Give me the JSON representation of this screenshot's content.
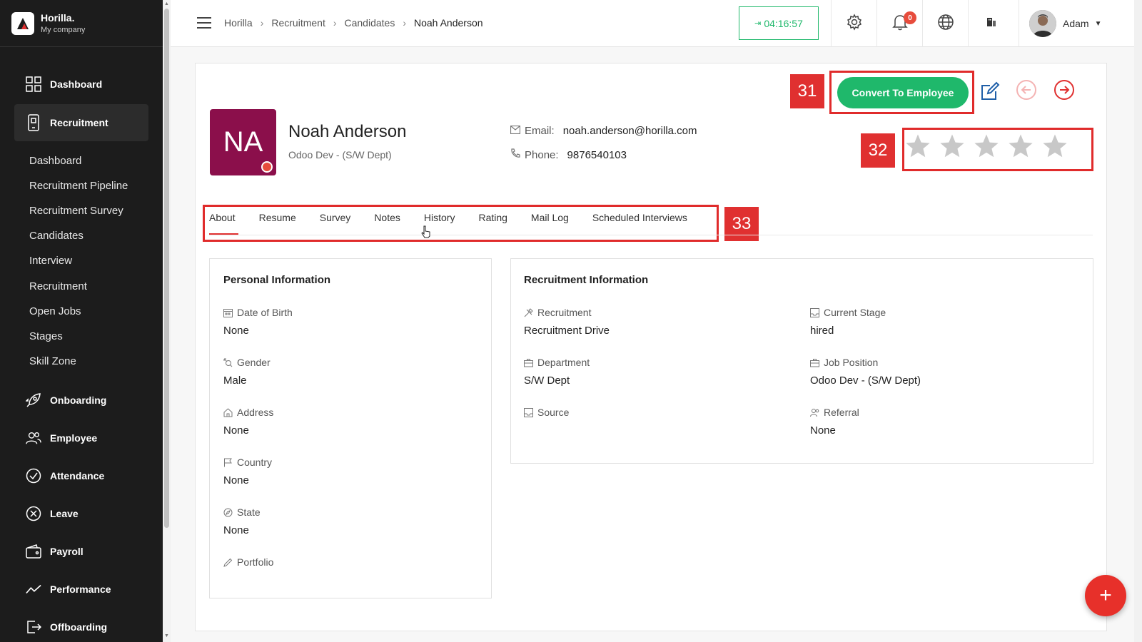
{
  "brand": {
    "name": "Horilla.",
    "company": "My company"
  },
  "sidebar": {
    "main_top": [
      {
        "label": "Dashboard",
        "icon": "grid-icon"
      },
      {
        "label": "Recruitment",
        "icon": "phone-icon"
      }
    ],
    "sub_items": [
      "Dashboard",
      "Recruitment Pipeline",
      "Recruitment Survey",
      "Candidates",
      "Interview",
      "Recruitment",
      "Open Jobs",
      "Stages",
      "Skill Zone"
    ],
    "main_bottom": [
      {
        "label": "Onboarding",
        "icon": "rocket-icon"
      },
      {
        "label": "Employee",
        "icon": "users-icon"
      },
      {
        "label": "Attendance",
        "icon": "check-circle-icon"
      },
      {
        "label": "Leave",
        "icon": "x-circle-icon"
      },
      {
        "label": "Payroll",
        "icon": "wallet-icon"
      },
      {
        "label": "Performance",
        "icon": "trend-icon"
      },
      {
        "label": "Offboarding",
        "icon": "exit-icon"
      }
    ]
  },
  "topbar": {
    "breadcrumb": [
      "Horilla",
      "Recruitment",
      "Candidates",
      "Noah Anderson"
    ],
    "timer": "04:16:57",
    "notification_count": "0",
    "user_name": "Adam"
  },
  "candidate": {
    "initials": "NA",
    "name": "Noah Anderson",
    "job": "Odoo Dev - (S/W Dept)",
    "email_label": "Email:",
    "email": "noah.anderson@horilla.com",
    "phone_label": "Phone:",
    "phone": "9876540103",
    "rating": 0
  },
  "actions": {
    "convert_label": "Convert To Employee"
  },
  "markers": {
    "m31": "31",
    "m32": "32",
    "m33": "33"
  },
  "tabs": [
    "About",
    "Resume",
    "Survey",
    "Notes",
    "History",
    "Rating",
    "Mail Log",
    "Scheduled Interviews"
  ],
  "personal": {
    "title": "Personal Information",
    "fields": [
      {
        "label": "Date of Birth",
        "value": "None"
      },
      {
        "label": "Gender",
        "value": "Male"
      },
      {
        "label": "Address",
        "value": "None"
      },
      {
        "label": "Country",
        "value": "None"
      },
      {
        "label": "State",
        "value": "None"
      },
      {
        "label": "Portfolio",
        "value": ""
      }
    ]
  },
  "recruitment_info": {
    "title": "Recruitment Information",
    "left": [
      {
        "label": "Recruitment",
        "value": "Recruitment Drive"
      },
      {
        "label": "Department",
        "value": "S/W Dept"
      },
      {
        "label": "Source",
        "value": ""
      }
    ],
    "right": [
      {
        "label": "Current Stage",
        "value": "hired"
      },
      {
        "label": "Job Position",
        "value": "Odoo Dev - (S/W Dept)"
      },
      {
        "label": "Referral",
        "value": "None"
      }
    ]
  },
  "colors": {
    "accent": "#1fb86b",
    "danger": "#e03030",
    "avatar_bg": "#8b0f4b",
    "sidebar_bg": "#1c1c1c"
  }
}
